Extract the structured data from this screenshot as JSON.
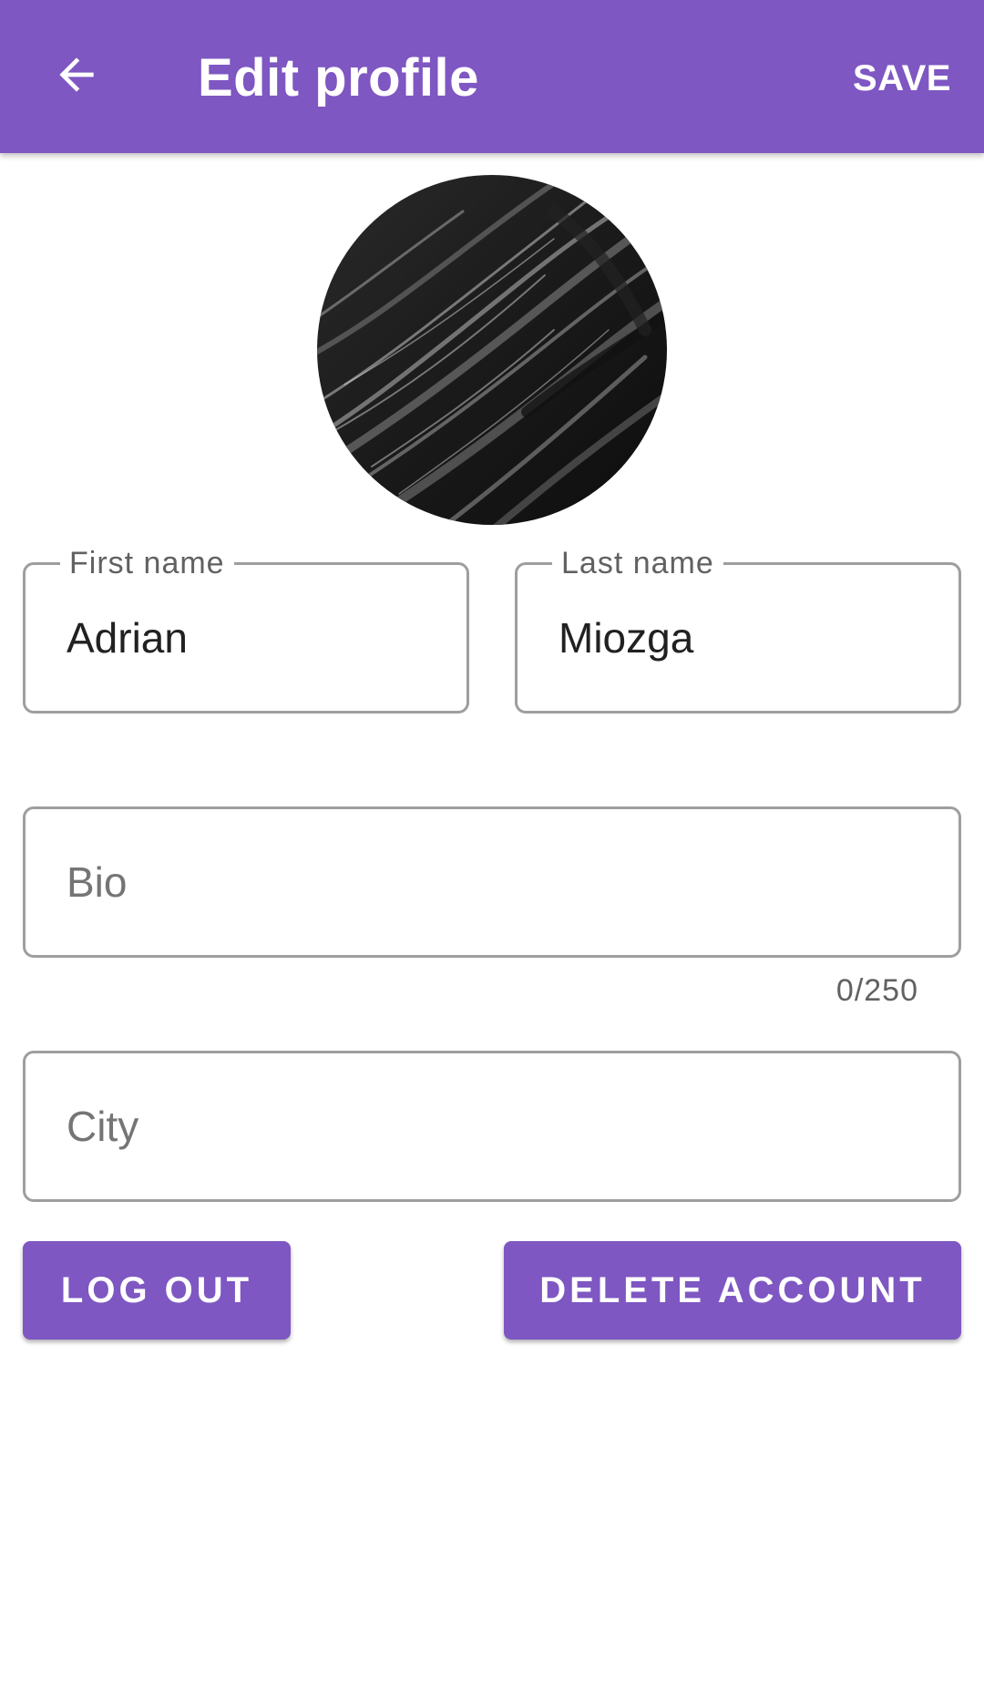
{
  "appbar": {
    "title": "Edit profile",
    "save_label": "SAVE",
    "back_icon": "arrow-left-icon",
    "color": "#7e57c2"
  },
  "avatar": {
    "description_icon": "profile-avatar-image"
  },
  "form": {
    "first_name": {
      "label": "First name",
      "value": "Adrian"
    },
    "last_name": {
      "label": "Last name",
      "value": "Miozga"
    },
    "bio": {
      "placeholder": "Bio",
      "value": "",
      "counter": "0/250"
    },
    "city": {
      "placeholder": "City",
      "value": ""
    }
  },
  "actions": {
    "logout_label": "LOG OUT",
    "delete_label": "DELETE ACCOUNT"
  },
  "colors": {
    "accent": "#7e57c2",
    "outline": "#9e9e9e",
    "text": "#212121",
    "hint": "#757575"
  }
}
